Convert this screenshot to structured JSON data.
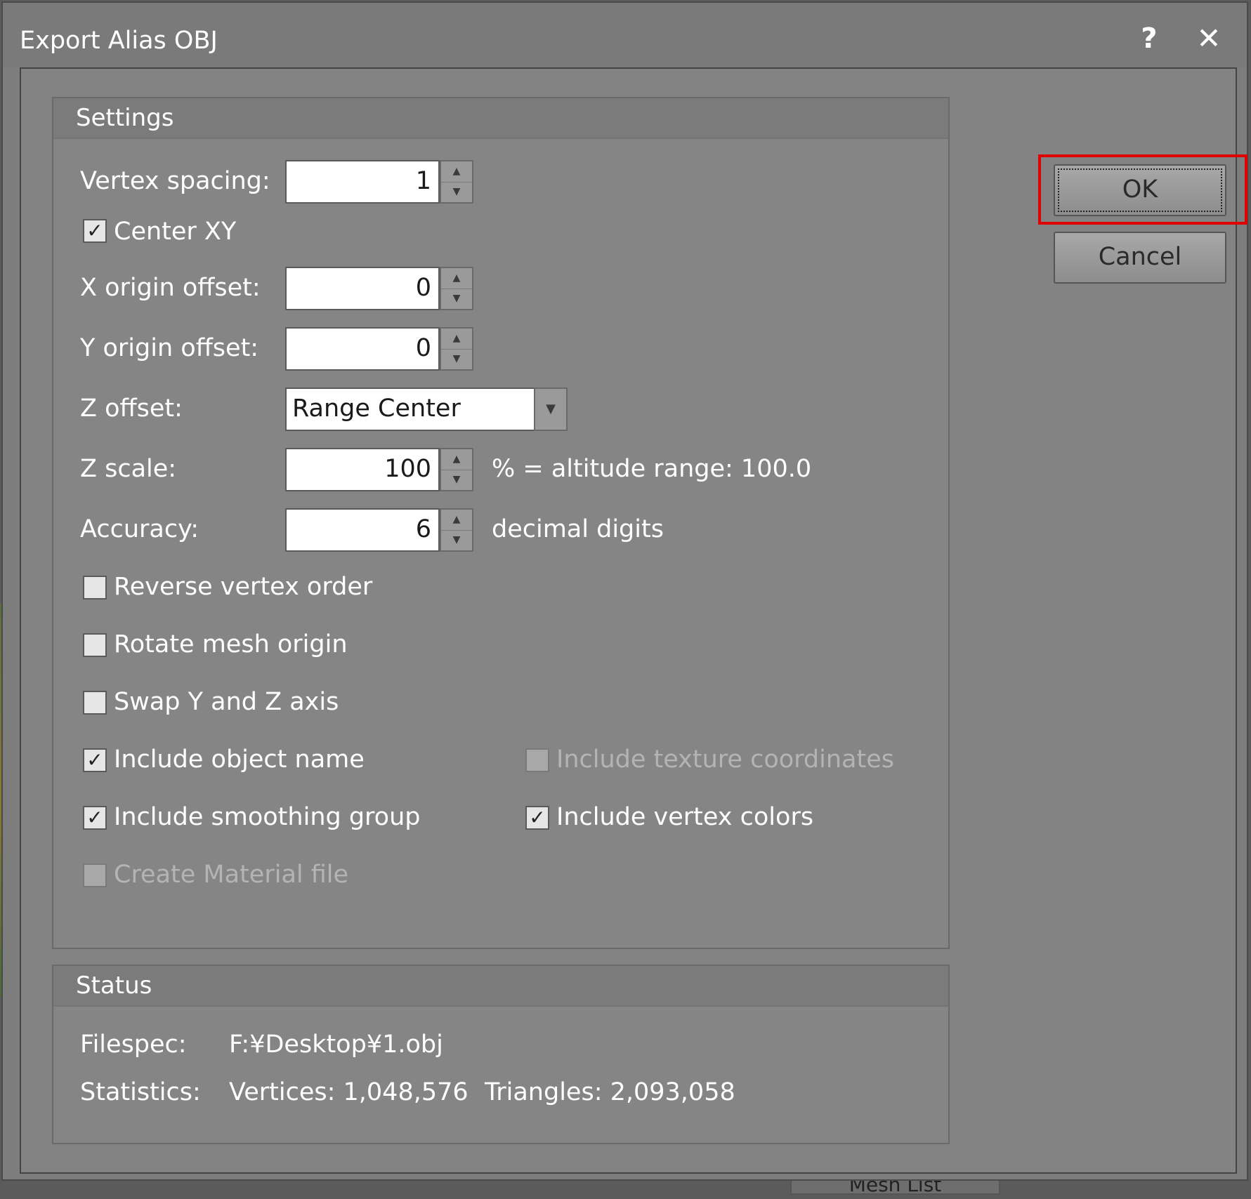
{
  "window": {
    "title": "Export Alias OBJ"
  },
  "background": {
    "bottom_tab_label": "Mesh List"
  },
  "buttons": {
    "ok": "OK",
    "cancel": "Cancel"
  },
  "settings": {
    "title": "Settings",
    "vertex_spacing": {
      "label": "Vertex spacing:",
      "value": "1"
    },
    "center_xy": {
      "label": "Center XY",
      "checked": true
    },
    "x_origin_offset": {
      "label": "X origin offset:",
      "value": "0"
    },
    "y_origin_offset": {
      "label": "Y origin offset:",
      "value": "0"
    },
    "z_offset": {
      "label": "Z offset:",
      "value": "Range Center"
    },
    "z_scale": {
      "label": "Z scale:",
      "value": "100",
      "suffix": "% = altitude range: 100.0"
    },
    "accuracy": {
      "label": "Accuracy:",
      "value": "6",
      "suffix": "decimal digits"
    },
    "reverse_vertex_order": {
      "label": "Reverse vertex order",
      "checked": false
    },
    "rotate_mesh_origin": {
      "label": "Rotate mesh origin",
      "checked": false
    },
    "swap_y_z": {
      "label": "Swap Y and Z axis",
      "checked": false
    },
    "include_object_name": {
      "label": "Include object name",
      "checked": true
    },
    "include_texture_coordinates": {
      "label": "Include texture coordinates",
      "checked": false,
      "disabled": true
    },
    "include_smoothing_group": {
      "label": "Include smoothing group",
      "checked": true
    },
    "include_vertex_colors": {
      "label": "Include vertex colors",
      "checked": true
    },
    "create_material_file": {
      "label": "Create Material file",
      "checked": false,
      "disabled": true
    }
  },
  "status": {
    "title": "Status",
    "filespec_label": "Filespec:",
    "filespec_value": "F:¥Desktop¥1.obj",
    "statistics_label": "Statistics:",
    "vertices": "Vertices: 1,048,576",
    "triangles": "Triangles: 2,093,058"
  },
  "icons": {
    "help": "help-icon",
    "close": "close-icon",
    "check": "✓",
    "spin_up": "▲",
    "spin_down": "▼",
    "dropdown": "▼"
  },
  "colors": {
    "highlight": "#e00000",
    "dialog_bg": "#838383"
  }
}
